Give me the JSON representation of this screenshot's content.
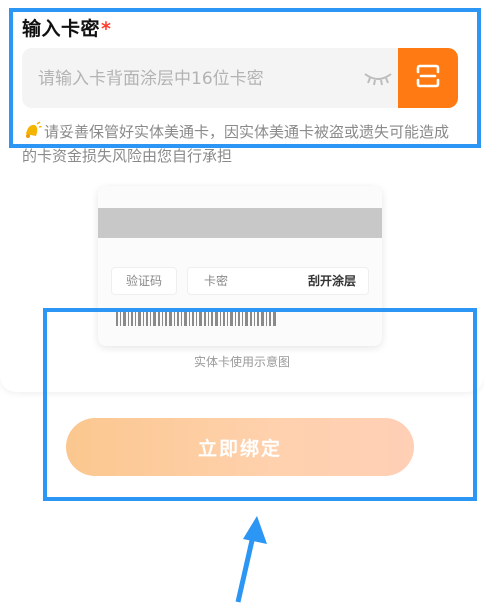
{
  "form": {
    "title": "输入卡密",
    "required_mark": "*",
    "input_placeholder": "请输入卡背面涂层中16位卡密",
    "input_value": ""
  },
  "tip": {
    "text": "请妥善保管好实体美通卡，因实体美通卡被盗或遗失可能造成的卡资金损失风险由您自行承担"
  },
  "sample_card": {
    "verify_label": "验证码",
    "pin_label": "卡密",
    "scratch_label": "刮开涂层",
    "caption": "实体卡使用示意图"
  },
  "actions": {
    "bind_label": "立即绑定"
  },
  "colors": {
    "accent_orange": "#ff7a12",
    "annotation_blue": "#2b96f3",
    "required_red": "#ff3b30"
  }
}
